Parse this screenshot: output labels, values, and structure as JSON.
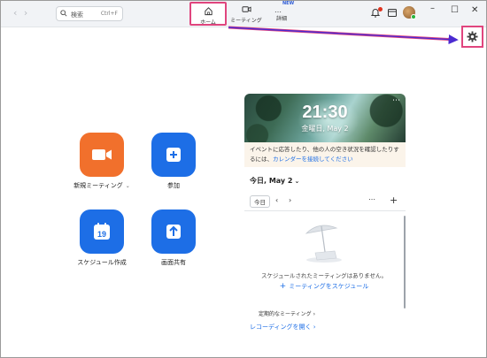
{
  "titlebar": {
    "search": {
      "label": "検索",
      "shortcut": "Ctrl+F"
    },
    "tabs": [
      {
        "label": "ホーム",
        "icon": "home-icon",
        "selected": true
      },
      {
        "label": "ミーティング",
        "icon": "meeting-icon"
      },
      {
        "label": "詳細",
        "icon": "more-dots-icon",
        "badge": "NEW"
      }
    ],
    "right_icons": [
      "bell-icon",
      "calendar-icon",
      "avatar",
      "settings-gear-icon"
    ],
    "window_controls": [
      "minimize",
      "maximize",
      "close"
    ]
  },
  "home_actions": [
    {
      "label": "新規ミーティング",
      "icon": "video-camera-icon",
      "color": "#f1702c",
      "has_dropdown": true
    },
    {
      "label": "参加",
      "icon": "plus-icon",
      "color": "#1d6ee6"
    },
    {
      "label": "スケジュール作成",
      "icon": "calendar-19-icon",
      "color": "#1d6ee6",
      "calendar_day": "19"
    },
    {
      "label": "画面共有",
      "icon": "share-screen-icon",
      "color": "#1d6ee6"
    }
  ],
  "calendar_panel": {
    "time": "21:30",
    "date": "金曜日, May 2",
    "notice_text": "イベントに応答したり、他の人の空き状況を確認したりするには、",
    "notice_link": "カレンダーを接続してください",
    "today_label": "今日, May 2",
    "today_button": "今日",
    "empty_message": "スケジュールされたミーティングはありません。",
    "schedule_link": "ミーティングをスケジュール",
    "recurring_label": "定期的なミーティング",
    "recording_link": "レコーディングを開く"
  },
  "annotation_color": "#e0457e",
  "accent_blue": "#1d6ee6"
}
